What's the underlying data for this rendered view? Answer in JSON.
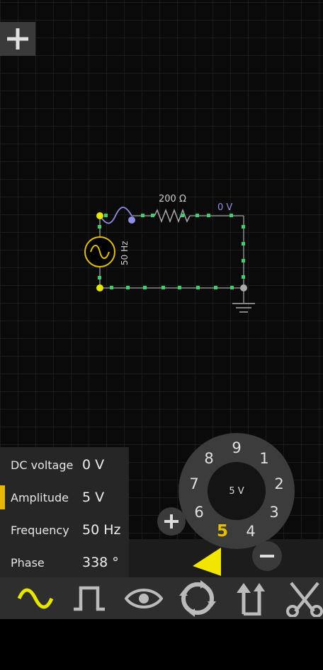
{
  "circuit": {
    "resistor_label": "200 Ω",
    "node_voltage_label": "0 V",
    "source_frequency_label": "50 Hz"
  },
  "properties": [
    {
      "label": "DC voltage",
      "value": "0 V",
      "selected": false
    },
    {
      "label": "Amplitude",
      "value": "5 V",
      "selected": true
    },
    {
      "label": "Frequency",
      "value": "50 Hz",
      "selected": false
    },
    {
      "label": "Phase",
      "value": "338 °",
      "selected": false
    }
  ],
  "dial": {
    "center_value": "5 V",
    "digits": [
      "9",
      "1",
      "2",
      "3",
      "4",
      "5",
      "6",
      "7",
      "8"
    ],
    "active_digit": "5"
  },
  "toolbar": {
    "tools": [
      "sine-wave-icon",
      "square-wave-icon",
      "eye-icon",
      "rotate-icon",
      "flip-icon",
      "cut-icon"
    ],
    "selected_tool": "sine-wave-icon"
  },
  "colors": {
    "accent": "#e6c000",
    "wire_marker": "#3bd16a",
    "node_blue": "#8f8fe8",
    "panel": "#262626"
  }
}
